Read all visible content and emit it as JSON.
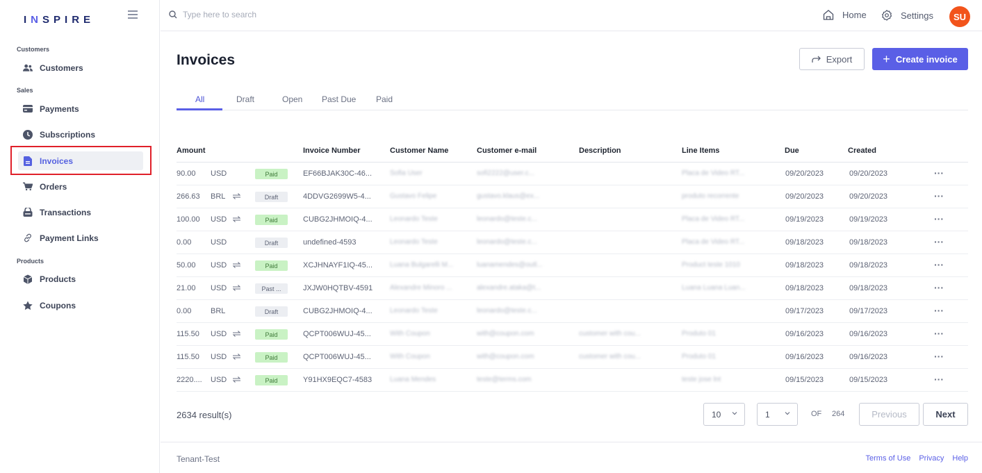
{
  "brand": {
    "logo_prefix": "I",
    "logo_n": "N",
    "logo_suffix": "SPIRE"
  },
  "search": {
    "placeholder": "Type here to search"
  },
  "topbar": {
    "home_label": "Home",
    "settings_label": "Settings",
    "avatar_initials": "SU"
  },
  "sidebar": {
    "sections": [
      "Customers",
      "Sales",
      "Products"
    ],
    "items": [
      {
        "label": "Customers",
        "icon": "users-icon"
      },
      {
        "label": "Payments",
        "icon": "card-icon"
      },
      {
        "label": "Subscriptions",
        "icon": "clock-icon"
      },
      {
        "label": "Invoices",
        "icon": "document-icon",
        "active": true
      },
      {
        "label": "Orders",
        "icon": "cart-icon"
      },
      {
        "label": "Transactions",
        "icon": "wallet-icon"
      },
      {
        "label": "Payment Links",
        "icon": "link-icon"
      },
      {
        "label": "Products",
        "icon": "box-icon"
      },
      {
        "label": "Coupons",
        "icon": "star-icon"
      }
    ]
  },
  "page": {
    "title": "Invoices",
    "export_label": "Export",
    "create_label": "Create invoice"
  },
  "tabs": [
    "All",
    "Draft",
    "Open",
    "Past Due",
    "Paid"
  ],
  "table": {
    "headers": [
      "Amount",
      "Invoice Number",
      "Customer Name",
      "Customer e-mail",
      "Description",
      "Line Items",
      "Due",
      "Created"
    ],
    "rows": [
      {
        "amount": "90.00",
        "currency": "USD",
        "recurring": false,
        "status": "Paid",
        "status_type": "paid",
        "invoice": "EF66BJAK30C-46...",
        "name": "Sofia User",
        "email": "sofi2222@user.c...",
        "desc": "",
        "items": "Placa de Video RT...",
        "due": "09/20/2023",
        "created": "09/20/2023"
      },
      {
        "amount": "266.63",
        "currency": "BRL",
        "recurring": true,
        "status": "Draft",
        "status_type": "draft",
        "invoice": "4DDVG2699W5-4...",
        "name": "Gustavo Felipe",
        "email": "gustavo.klaus@ex...",
        "desc": "",
        "items": "produto recorrente",
        "due": "09/20/2023",
        "created": "09/20/2023"
      },
      {
        "amount": "100.00",
        "currency": "USD",
        "recurring": true,
        "status": "Paid",
        "status_type": "paid",
        "invoice": "CUBG2JHMOIQ-4...",
        "name": "Leonardo Teste",
        "email": "leonardo@teste.c...",
        "desc": "",
        "items": "Placa de Video RT...",
        "due": "09/19/2023",
        "created": "09/19/2023"
      },
      {
        "amount": "0.00",
        "currency": "USD",
        "recurring": false,
        "status": "Draft",
        "status_type": "draft",
        "invoice": "undefined-4593",
        "name": "Leonardo Teste",
        "email": "leonardo@teste.c...",
        "desc": "",
        "items": "Placa de Video RT...",
        "due": "09/18/2023",
        "created": "09/18/2023"
      },
      {
        "amount": "50.00",
        "currency": "USD",
        "recurring": true,
        "status": "Paid",
        "status_type": "paid",
        "invoice": "XCJHNAYF1IQ-45...",
        "name": "Luana Bulgarelli M...",
        "email": "luanamendes@outl...",
        "desc": "",
        "items": "Product teste 1010",
        "due": "09/18/2023",
        "created": "09/18/2023"
      },
      {
        "amount": "21.00",
        "currency": "USD",
        "recurring": true,
        "status": "Past ...",
        "status_type": "pastdue",
        "invoice": "JXJW0HQTBV-4591",
        "name": "Alexandre Minoro ...",
        "email": "alexandre.ataka@t...",
        "desc": "",
        "items": "Luana Luana Luan...",
        "due": "09/18/2023",
        "created": "09/18/2023"
      },
      {
        "amount": "0.00",
        "currency": "BRL",
        "recurring": false,
        "status": "Draft",
        "status_type": "draft",
        "invoice": "CUBG2JHMOIQ-4...",
        "name": "Leonardo Teste",
        "email": "leonardo@teste.c...",
        "desc": "",
        "items": "",
        "due": "09/17/2023",
        "created": "09/17/2023"
      },
      {
        "amount": "115.50",
        "currency": "USD",
        "recurring": true,
        "status": "Paid",
        "status_type": "paid",
        "invoice": "QCPT006WUJ-45...",
        "name": "With Coupon",
        "email": "with@coupon.com",
        "desc": "customer with cou...",
        "items": "Produto 01",
        "due": "09/16/2023",
        "created": "09/16/2023"
      },
      {
        "amount": "115.50",
        "currency": "USD",
        "recurring": true,
        "status": "Paid",
        "status_type": "paid",
        "invoice": "QCPT006WUJ-45...",
        "name": "With Coupon",
        "email": "with@coupon.com",
        "desc": "customer with cou...",
        "items": "Produto 01",
        "due": "09/16/2023",
        "created": "09/16/2023"
      },
      {
        "amount": "2220....",
        "currency": "USD",
        "recurring": true,
        "status": "Paid",
        "status_type": "paid",
        "invoice": "Y91HX9EQC7-4583",
        "name": "Luana Mendes",
        "email": "teste@terms.com",
        "desc": "",
        "items": "teste jose lnt",
        "due": "09/15/2023",
        "created": "09/15/2023"
      }
    ]
  },
  "pagination": {
    "results": "2634 result(s)",
    "page_size": "10",
    "page": "1",
    "of_label": "OF",
    "total_pages": "264",
    "prev_label": "Previous",
    "next_label": "Next"
  },
  "footer": {
    "tenant": "Tenant-Test",
    "links": [
      "Terms of Use",
      "Privacy",
      "Help"
    ]
  },
  "colors": {
    "accent": "#5a5fe6",
    "paid_bg": "#c9f2c4",
    "avatar": "#f2541b",
    "highlight": "#e0202a"
  }
}
